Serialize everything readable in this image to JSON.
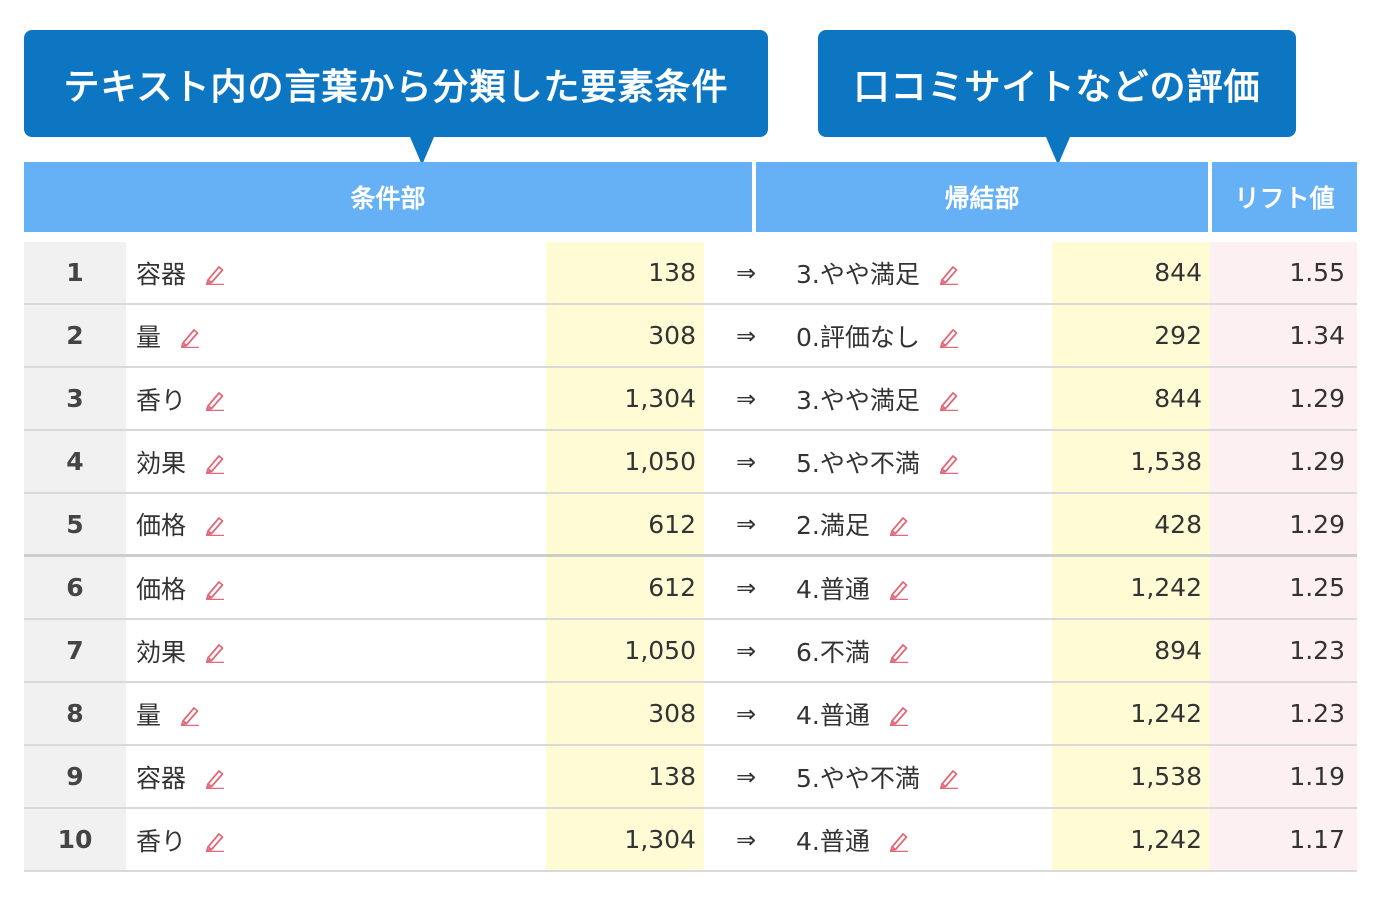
{
  "callouts": {
    "left": "テキスト内の言葉から分類した要素条件",
    "right": "口コミサイトなどの評価"
  },
  "header": {
    "condition": "条件部",
    "consequent": "帰結部",
    "lift": "リフト値"
  },
  "arrow_symbol": "⇒",
  "colors": {
    "callout": "#0d76c3",
    "header": "#66b0f5",
    "count_bg": "#fefbd5",
    "lift_bg": "#fdf0f3",
    "rank_bg": "#f1f1f1",
    "edit_icon": "#e06a7a"
  },
  "rows": [
    {
      "rank": "1",
      "condition": "容器",
      "condition_count": "138",
      "consequent": "3.やや満足",
      "consequent_count": "844",
      "lift": "1.55"
    },
    {
      "rank": "2",
      "condition": "量",
      "condition_count": "308",
      "consequent": "0.評価なし",
      "consequent_count": "292",
      "lift": "1.34"
    },
    {
      "rank": "3",
      "condition": "香り",
      "condition_count": "1,304",
      "consequent": "3.やや満足",
      "consequent_count": "844",
      "lift": "1.29"
    },
    {
      "rank": "4",
      "condition": "効果",
      "condition_count": "1,050",
      "consequent": "5.やや不満",
      "consequent_count": "1,538",
      "lift": "1.29"
    },
    {
      "rank": "5",
      "condition": "価格",
      "condition_count": "612",
      "consequent": "2.満足",
      "consequent_count": "428",
      "lift": "1.29"
    },
    {
      "rank": "6",
      "condition": "価格",
      "condition_count": "612",
      "consequent": "4.普通",
      "consequent_count": "1,242",
      "lift": "1.25"
    },
    {
      "rank": "7",
      "condition": "効果",
      "condition_count": "1,050",
      "consequent": "6.不満",
      "consequent_count": "894",
      "lift": "1.23"
    },
    {
      "rank": "8",
      "condition": "量",
      "condition_count": "308",
      "consequent": "4.普通",
      "consequent_count": "1,242",
      "lift": "1.23"
    },
    {
      "rank": "9",
      "condition": "容器",
      "condition_count": "138",
      "consequent": "5.やや不満",
      "consequent_count": "1,538",
      "lift": "1.19"
    },
    {
      "rank": "10",
      "condition": "香り",
      "condition_count": "1,304",
      "consequent": "4.普通",
      "consequent_count": "1,242",
      "lift": "1.17"
    }
  ]
}
